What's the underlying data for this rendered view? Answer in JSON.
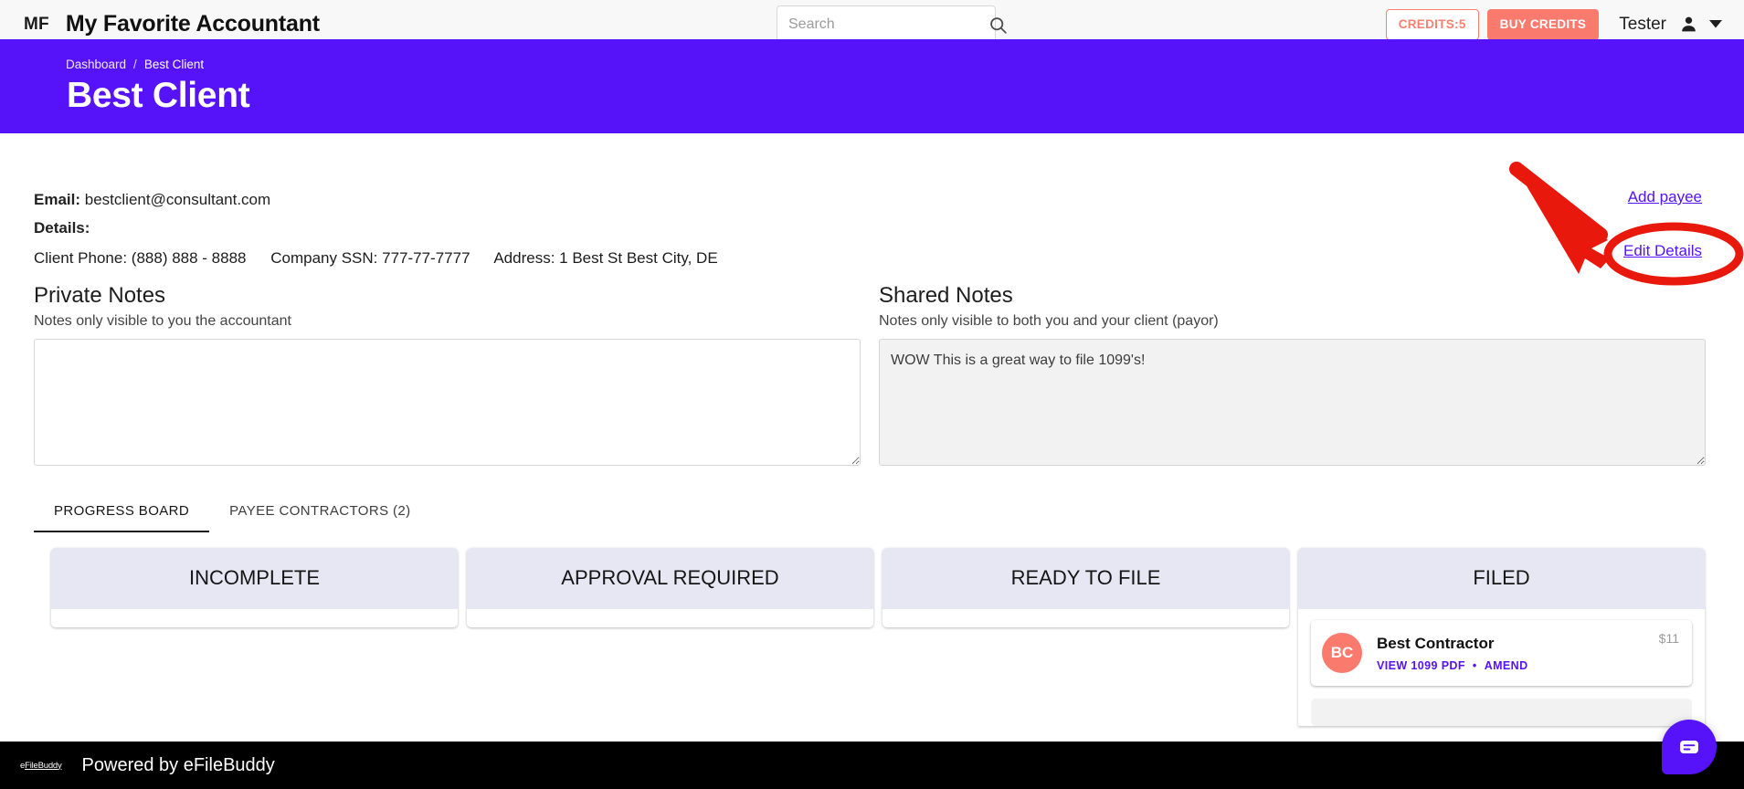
{
  "topbar": {
    "brand_mark": "MF",
    "brand_name": "My Favorite Accountant",
    "search_placeholder": "Search",
    "search_value": "",
    "search_icon": "search-icon",
    "credits_label": "CREDITS:5",
    "buy_credits_label": "BUY CREDITS",
    "user_name": "Tester",
    "avatar_icon": "person-icon",
    "caret_icon": "chevron-down-icon",
    "accent_coral": "#fa7a6d",
    "bg": "#f8f8f8"
  },
  "hero": {
    "breadcrumb_root": "Dashboard",
    "breadcrumb_sep": "/",
    "breadcrumb_current": "Best Client",
    "title": "Best Client",
    "bg": "#5613fa"
  },
  "details": {
    "email_label": "Email:",
    "email_value": "bestclient@consultant.com",
    "details_label": "Details:",
    "phone": "Client Phone: (888) 888 - 8888",
    "ssn": "Company SSN: 777-77-7777",
    "address": "Address: 1 Best St Best City, DE"
  },
  "links": {
    "add_payee": "Add payee",
    "edit_details": "Edit Details",
    "link_color": "#5613fa",
    "annotation_color": "#e8180c"
  },
  "notes": {
    "private": {
      "heading": "Private Notes",
      "subtitle": "Notes only visible to you the accountant",
      "value": "",
      "placeholder": ""
    },
    "shared": {
      "heading": "Shared Notes",
      "subtitle": "Notes only visible to both you and your client (payor)",
      "value": "WOW This is a great way to file 1099's!",
      "placeholder": ""
    }
  },
  "tabs": [
    {
      "label": "PROGRESS BOARD",
      "active": true
    },
    {
      "label": "PAYEE CONTRACTORS (2)",
      "active": false
    }
  ],
  "board": {
    "columns": [
      {
        "title": "INCOMPLETE",
        "cards": []
      },
      {
        "title": "APPROVAL REQUIRED",
        "cards": []
      },
      {
        "title": "READY TO FILE",
        "cards": []
      },
      {
        "title": "FILED",
        "cards": [
          {
            "initials": "BC",
            "name": "Best Contractor",
            "amount": "$11",
            "action_view": "VIEW 1099 PDF",
            "action_sep": "•",
            "action_amend": "AMEND",
            "avatar_color": "#fa7a6d"
          }
        ]
      }
    ]
  },
  "footer": {
    "logo_prefix": "e",
    "logo_main": "FileBuddy",
    "text": "Powered by eFileBuddy",
    "bg": "#000000"
  },
  "chat": {
    "icon": "chat-bubble-icon",
    "color": "#5613fa"
  }
}
